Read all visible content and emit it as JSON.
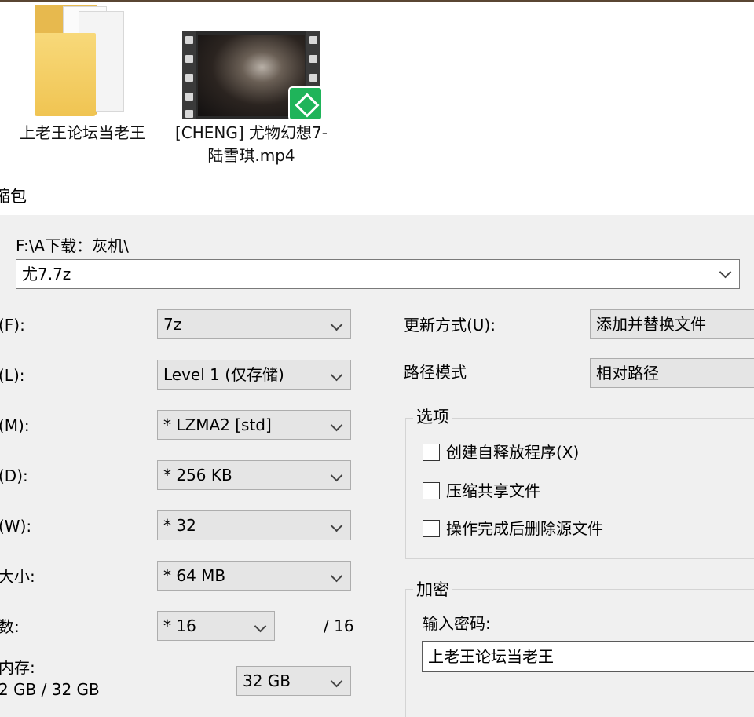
{
  "desktop": {
    "folder": {
      "label": "上老王论坛当老王",
      "icon": "folder-icon"
    },
    "video": {
      "label": "[CHENG] 尤物幻想7-陆雪琪.mp4",
      "icon": "video-file-icon"
    }
  },
  "dialog": {
    "title": "缩包",
    "archive": {
      "path": "F:\\A下载：灰机\\",
      "name": "尤7.7z"
    },
    "left": {
      "format": {
        "label": "(F):",
        "value": "7z"
      },
      "level": {
        "label": "(L):",
        "value": "Level 1 (仅存储)"
      },
      "method": {
        "label": "(M):",
        "value": "*  LZMA2 [std]"
      },
      "dictionary": {
        "label": "(D):",
        "value": "*  256 KB"
      },
      "word": {
        "label": "(W):",
        "value": "*  32"
      },
      "solid": {
        "label": "大小:",
        "value": "*  64 MB"
      },
      "threads": {
        "label": "数:",
        "value": "*  16",
        "max": "/ 16"
      },
      "memory": {
        "label": "内存:",
        "usage": "2 GB / 32 GB",
        "value": "32 GB"
      }
    },
    "right": {
      "update_mode": {
        "label": "更新方式(U):",
        "value": "添加并替换文件"
      },
      "path_mode": {
        "label": "路径模式",
        "value": "相对路径"
      },
      "options": {
        "title": "选项",
        "items": [
          {
            "label": "创建自释放程序(X)",
            "checked": false
          },
          {
            "label": "压缩共享文件",
            "checked": false
          },
          {
            "label": "操作完成后删除源文件",
            "checked": false
          }
        ]
      },
      "encryption": {
        "title": "加密",
        "password_label": "输入密码:",
        "password_value": "上老王论坛当老王"
      }
    }
  }
}
